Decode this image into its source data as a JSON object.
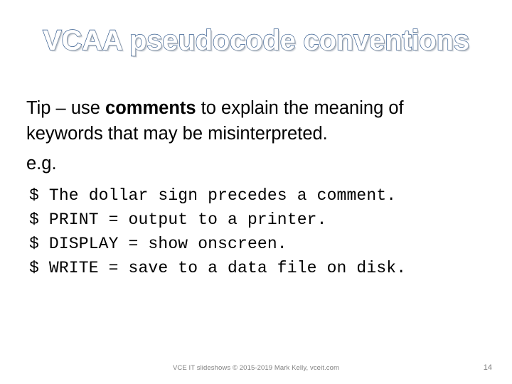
{
  "slide": {
    "title": "VCAA pseudocode conventions",
    "title_outline_color": "#31598c",
    "title_fill_color": "#ffffff",
    "background_color": "#ffffff",
    "body": {
      "line1_prefix": "Tip – use ",
      "line1_bold": "comments",
      "line1_suffix": " to explain the meaning of",
      "line2": "keywords that may be misinterpreted.",
      "eg": "e.g."
    },
    "code_lines": [
      "$ The dollar sign precedes a comment.",
      "$ PRINT = output to a printer.",
      "$ DISPLAY = show onscreen.",
      "$ WRITE = save to a data file on disk."
    ],
    "footer": {
      "credit": "VCE IT slideshows © 2015-2019 Mark Kelly, vceit.com",
      "page_number": "14",
      "text_color": "#808080"
    }
  }
}
